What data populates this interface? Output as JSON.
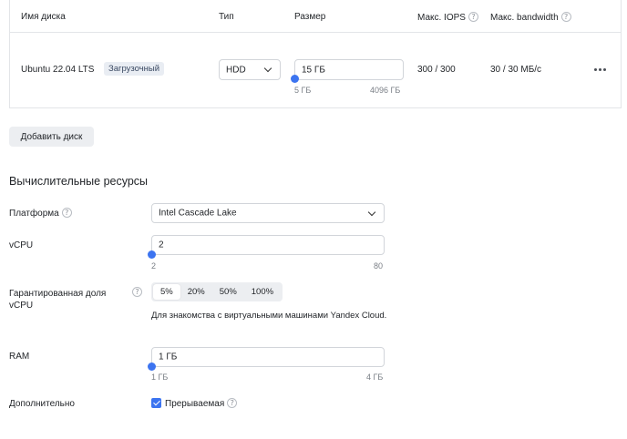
{
  "disk_table": {
    "columns": {
      "name": "Имя диска",
      "type": "Тип",
      "size": "Размер",
      "max_iops": "Макс. IOPS",
      "max_bandwidth": "Макс. bandwidth"
    },
    "row": {
      "name": "Ubuntu 22.04 LTS",
      "badge": "Загрузочный",
      "type": "HDD",
      "size": "15 ГБ",
      "size_min": "5 ГБ",
      "size_max": "4096 ГБ",
      "size_level_percent": 0.2,
      "iops": "300 / 300",
      "bandwidth": "30 / 30 МБ/с"
    }
  },
  "add_disk_label": "Добавить диск",
  "compute": {
    "title": "Вычислительные ресурсы",
    "platform": {
      "label": "Платформа",
      "value": "Intel Cascade Lake"
    },
    "vcpu": {
      "label": "vCPU",
      "value": "2",
      "min": "2",
      "max": "80"
    },
    "core_fraction": {
      "label": "Гарантированная доля vCPU",
      "options": [
        "5%",
        "20%",
        "50%",
        "100%"
      ],
      "selected": "5%",
      "note": "Для знакомства с виртуальными машинами Yandex Cloud."
    },
    "ram": {
      "label": "RAM",
      "value": "1 ГБ",
      "min": "1 ГБ",
      "max": "4 ГБ"
    },
    "additional": {
      "label": "Дополнительно",
      "preemptible_label": "Прерываемая",
      "preemptible_checked": true
    }
  },
  "colors": {
    "accent": "#3c74f0",
    "border": "#d2d5da",
    "button_bg": "#eceef1"
  }
}
